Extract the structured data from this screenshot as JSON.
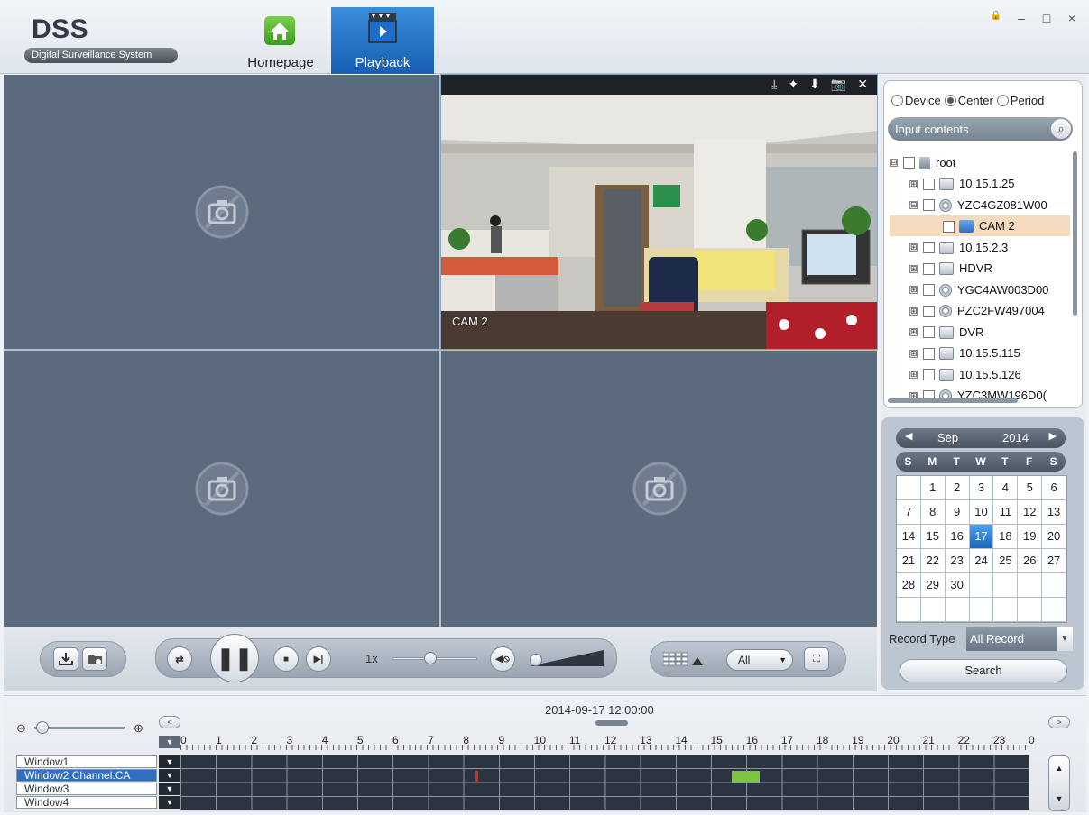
{
  "app": {
    "logo_title": "DSS",
    "logo_subtitle": "Digital Surveillance System",
    "tabs": [
      {
        "label": "Homepage",
        "active": false
      },
      {
        "label": "Playback",
        "active": true
      }
    ],
    "window_controls": {
      "lock": "🔒",
      "minimize": "–",
      "maximize": "□",
      "close": "×"
    }
  },
  "video": {
    "active_pane_channel_label": "CAM 2",
    "pane_toolbar_icons": [
      "⤓",
      "✦",
      "⬇",
      "📷",
      "✕"
    ]
  },
  "controls": {
    "speed": "1x",
    "speed_level": 0.45,
    "volume_level": 0.0,
    "split_filter": "All"
  },
  "tree": {
    "modes": [
      {
        "label": "Device",
        "selected": false
      },
      {
        "label": "Center",
        "selected": true
      },
      {
        "label": "Period",
        "selected": false
      }
    ],
    "search_placeholder": "Input contents",
    "nodes": [
      {
        "label": "root",
        "level": 0,
        "expander": "⊟",
        "icon": "root",
        "selected": false
      },
      {
        "label": "10.15.1.25",
        "level": 1,
        "expander": "⊞",
        "icon": "dvr",
        "selected": false
      },
      {
        "label": "YZC4GZ081W00",
        "level": 1,
        "expander": "⊟",
        "icon": "cam",
        "selected": false
      },
      {
        "label": "CAM 2",
        "level": 2,
        "expander": "",
        "icon": "ch",
        "selected": true
      },
      {
        "label": "10.15.2.3",
        "level": 1,
        "expander": "⊞",
        "icon": "dvr",
        "selected": false
      },
      {
        "label": "HDVR",
        "level": 1,
        "expander": "⊞",
        "icon": "dvr",
        "selected": false
      },
      {
        "label": "YGC4AW003D00",
        "level": 1,
        "expander": "⊞",
        "icon": "cam",
        "selected": false
      },
      {
        "label": "PZC2FW497004",
        "level": 1,
        "expander": "⊞",
        "icon": "cam",
        "selected": false
      },
      {
        "label": "DVR",
        "level": 1,
        "expander": "⊞",
        "icon": "dvr",
        "selected": false
      },
      {
        "label": "10.15.5.115",
        "level": 1,
        "expander": "⊞",
        "icon": "dvr",
        "selected": false
      },
      {
        "label": "10.15.5.126",
        "level": 1,
        "expander": "⊞",
        "icon": "dvr",
        "selected": false
      },
      {
        "label": "YZC3MW196D0(",
        "level": 1,
        "expander": "⊞",
        "icon": "cam",
        "selected": false
      }
    ]
  },
  "calendar": {
    "prev": "◀",
    "next": "▶",
    "month": "Sep",
    "year": "2014",
    "weekdays": [
      "S",
      "M",
      "T",
      "W",
      "T",
      "F",
      "S"
    ],
    "cells": [
      "",
      "1",
      "2",
      "3",
      "4",
      "5",
      "6",
      "7",
      "8",
      "9",
      "10",
      "11",
      "12",
      "13",
      "14",
      "15",
      "16",
      "17",
      "18",
      "19",
      "20",
      "21",
      "22",
      "23",
      "24",
      "25",
      "26",
      "27",
      "28",
      "29",
      "30",
      "",
      "",
      "",
      "",
      "",
      "",
      "",
      "",
      "",
      "",
      ""
    ],
    "selected_day": "17"
  },
  "record": {
    "type_label": "Record Type",
    "type_value": "All Record",
    "search_label": "Search"
  },
  "timeline": {
    "current_time": "2014-09-17 12:00:00",
    "hours": [
      "0",
      "1",
      "2",
      "3",
      "4",
      "5",
      "6",
      "7",
      "8",
      "9",
      "10",
      "11",
      "12",
      "13",
      "14",
      "15",
      "16",
      "17",
      "18",
      "19",
      "20",
      "21",
      "22",
      "23",
      "0"
    ],
    "windows": [
      {
        "label": "Window1",
        "selected": false
      },
      {
        "label": "Window2 Channel:CA",
        "selected": true
      },
      {
        "label": "Window3",
        "selected": false
      },
      {
        "label": "Window4",
        "selected": false
      }
    ],
    "records": [
      {
        "window": 1,
        "start_hour": 8.35,
        "end_hour": 8.42,
        "color": "#d02a2a"
      },
      {
        "window": 1,
        "start_hour": 15.6,
        "end_hour": 16.4,
        "color": "#7cc33f"
      }
    ]
  }
}
